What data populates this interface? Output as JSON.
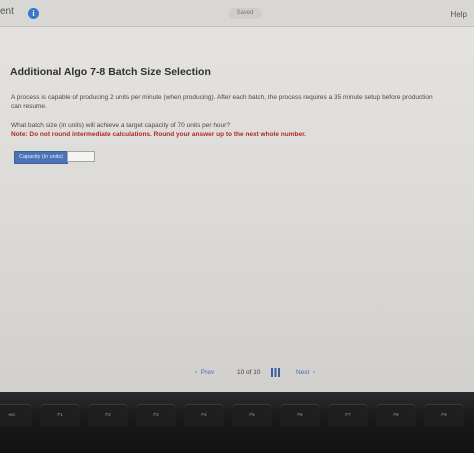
{
  "header": {
    "left_text": "ent",
    "saved_label": "Saved",
    "help_label": "Help"
  },
  "question": {
    "title": "Additional Algo 7-8 Batch Size Selection",
    "paragraph": "A process is capable of producing 2 units per minute (when producing). After each batch, the process requires a 35 minute setup before production can resume.",
    "prompt": "What batch size (in units) will achieve a target capacity of 70 units per hour?",
    "note": "Note: Do not round intermediate calculations. Round your answer up to the next whole number."
  },
  "answer": {
    "label": "Capacity (in units)",
    "value": ""
  },
  "pager": {
    "prev_label": "Prev",
    "page_current": "10",
    "page_of": "of",
    "page_total": "10",
    "next_label": "Next"
  },
  "keyboard": {
    "keys": [
      "esc",
      "F1",
      "F2",
      "F3",
      "F4",
      "F5",
      "F6",
      "F7",
      "F8",
      "F9"
    ]
  },
  "colors": {
    "accent": "#4a73b5",
    "note": "#b02a2a"
  }
}
